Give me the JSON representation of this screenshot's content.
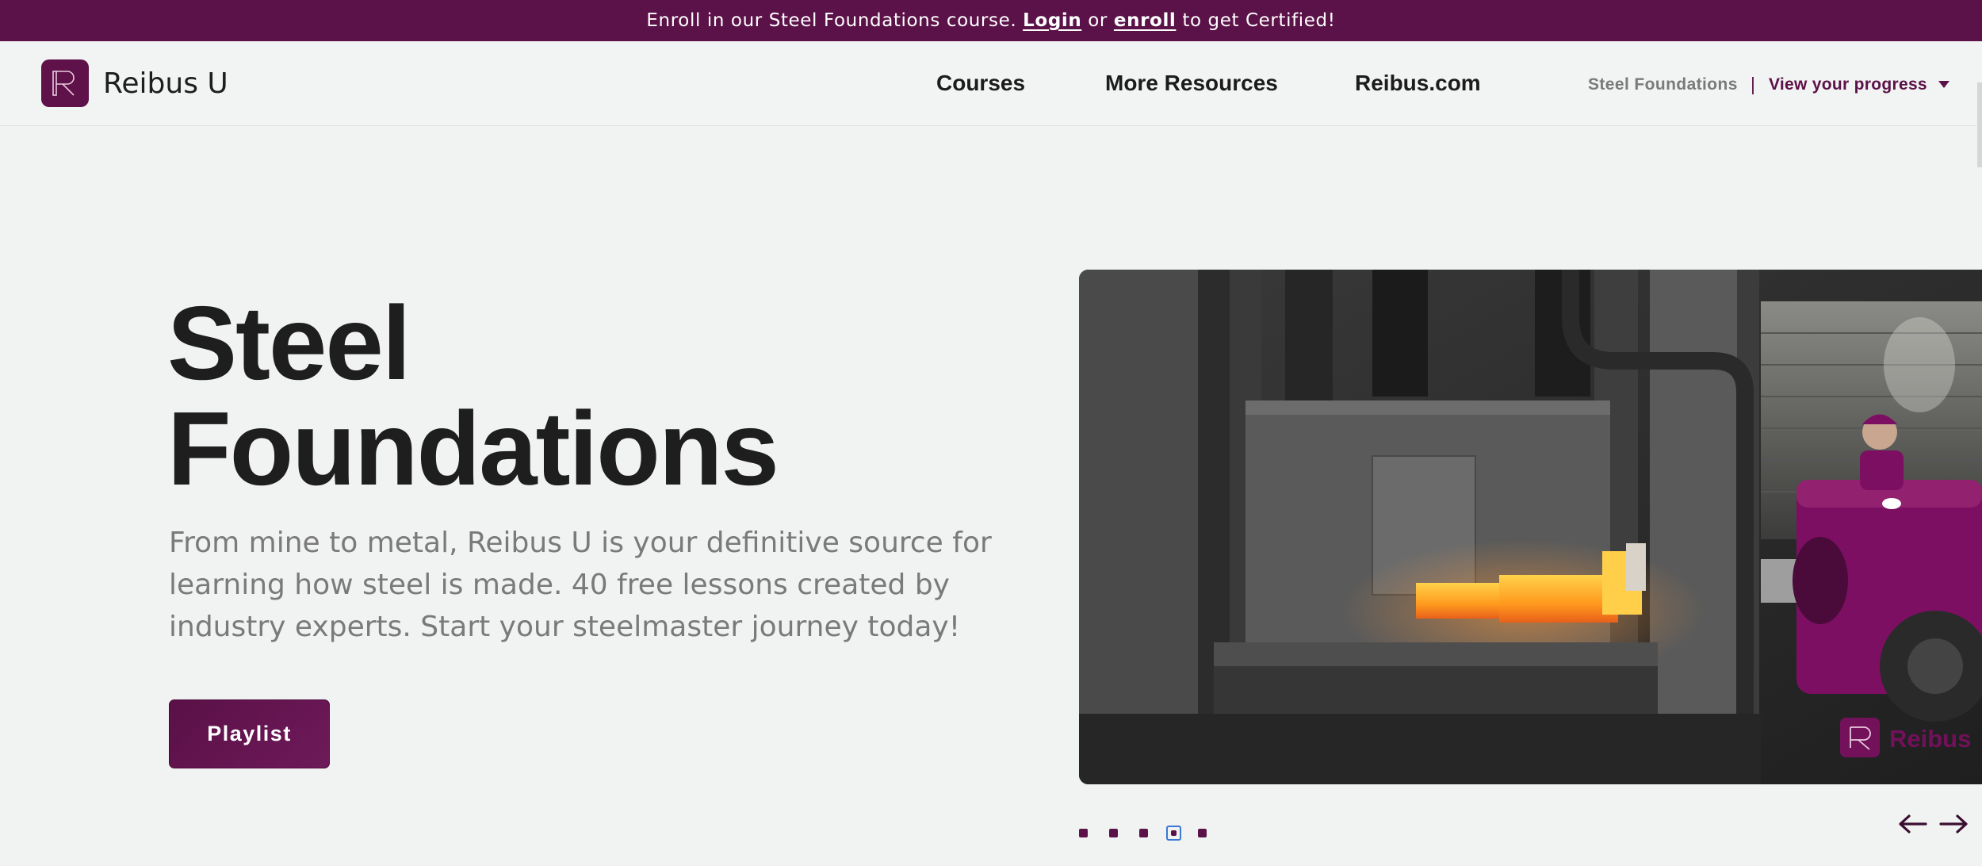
{
  "banner": {
    "text_before": "Enroll in our Steel Foundations course.",
    "login_label": "Login",
    "or_text": "or",
    "enroll_label": "enroll",
    "text_after": "to get Certified!",
    "color": "#5b1248"
  },
  "header": {
    "logo_icon": "reibus-r-logo-icon",
    "brand_name": "Reibus U",
    "nav_items": [
      {
        "label": "Courses"
      },
      {
        "label": "More Resources"
      },
      {
        "label": "Reibus.com"
      }
    ],
    "course_name": "Steel Foundations",
    "separator": "|",
    "progress_label": "View your progress",
    "progress_icon": "chevron-down-icon"
  },
  "hero": {
    "title_line1": "Steel",
    "title_line2": "Foundations",
    "description": "From mine to metal, Reibus U is your definitive source for learning how steel is made. 40 free lessons created by industry experts. Start your steelmaster journey today!",
    "button_label": "Playlist",
    "accent": "#5b1248"
  },
  "media": {
    "watermark_text": "Reibus",
    "subject": "forge press with glowing hot steel block and operator in purple vehicle"
  },
  "carousel": {
    "slide_count": 5,
    "active_index": 3,
    "prev_icon": "arrow-left-icon",
    "next_icon": "arrow-right-icon"
  }
}
